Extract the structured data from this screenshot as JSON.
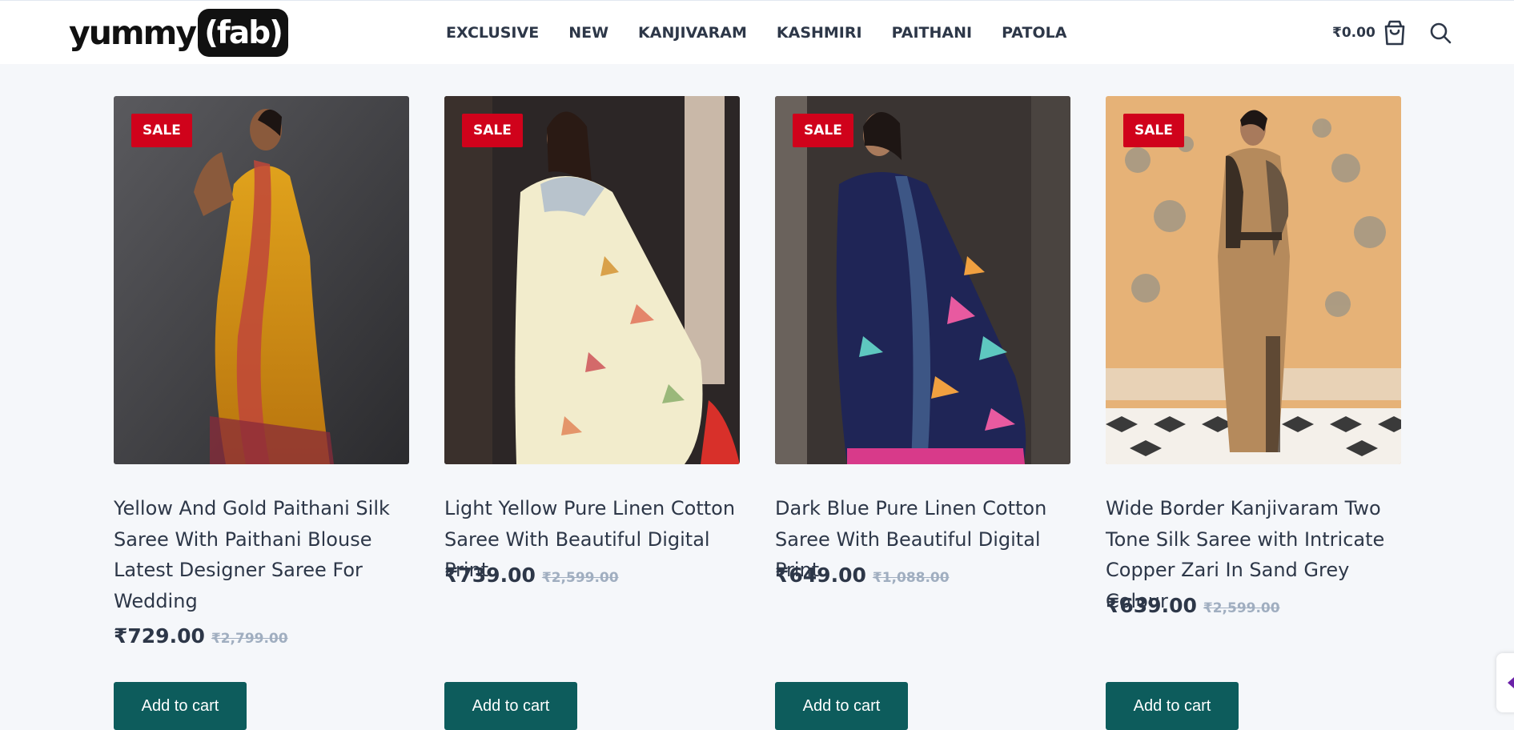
{
  "header": {
    "logo_text": "yummy",
    "logo_pill": "(fab)",
    "nav": [
      "EXCLUSIVE",
      "NEW",
      "KANJIVARAM",
      "KASHMIRI",
      "PAITHANI",
      "PATOLA"
    ],
    "cart_total": "₹0.00",
    "cart_icon": "shopping-bag-icon",
    "search_icon": "search-icon"
  },
  "products": [
    {
      "badge": "SALE",
      "title": "Yellow And Gold Paithani Silk Saree With Paithani Blouse Latest Designer Saree For Wedding",
      "price": "₹729.00",
      "original_price": "₹2,799.00",
      "button": "Add to cart"
    },
    {
      "badge": "SALE",
      "title": "Light Yellow Pure Linen Cotton Saree With Beautiful Digital Print",
      "price": "₹739.00",
      "original_price": "₹2,599.00",
      "button": "Add to cart"
    },
    {
      "badge": "SALE",
      "title": "Dark Blue Pure Linen Cotton Saree With Beautiful Digital Print",
      "price": "₹649.00",
      "original_price": "₹1,088.00",
      "button": "Add to cart"
    },
    {
      "badge": "SALE",
      "title": "Wide Border Kanjivaram Two Tone Silk Saree with Intricate Copper Zari In Sand Grey Colour",
      "price": "₹639.00",
      "original_price": "₹2,599.00",
      "button": "Add to cart"
    }
  ],
  "colors": {
    "accent_button": "#0d5c5c",
    "sale_badge": "#d0021b",
    "text": "#2d3748",
    "strike_price": "#a0aec0"
  }
}
